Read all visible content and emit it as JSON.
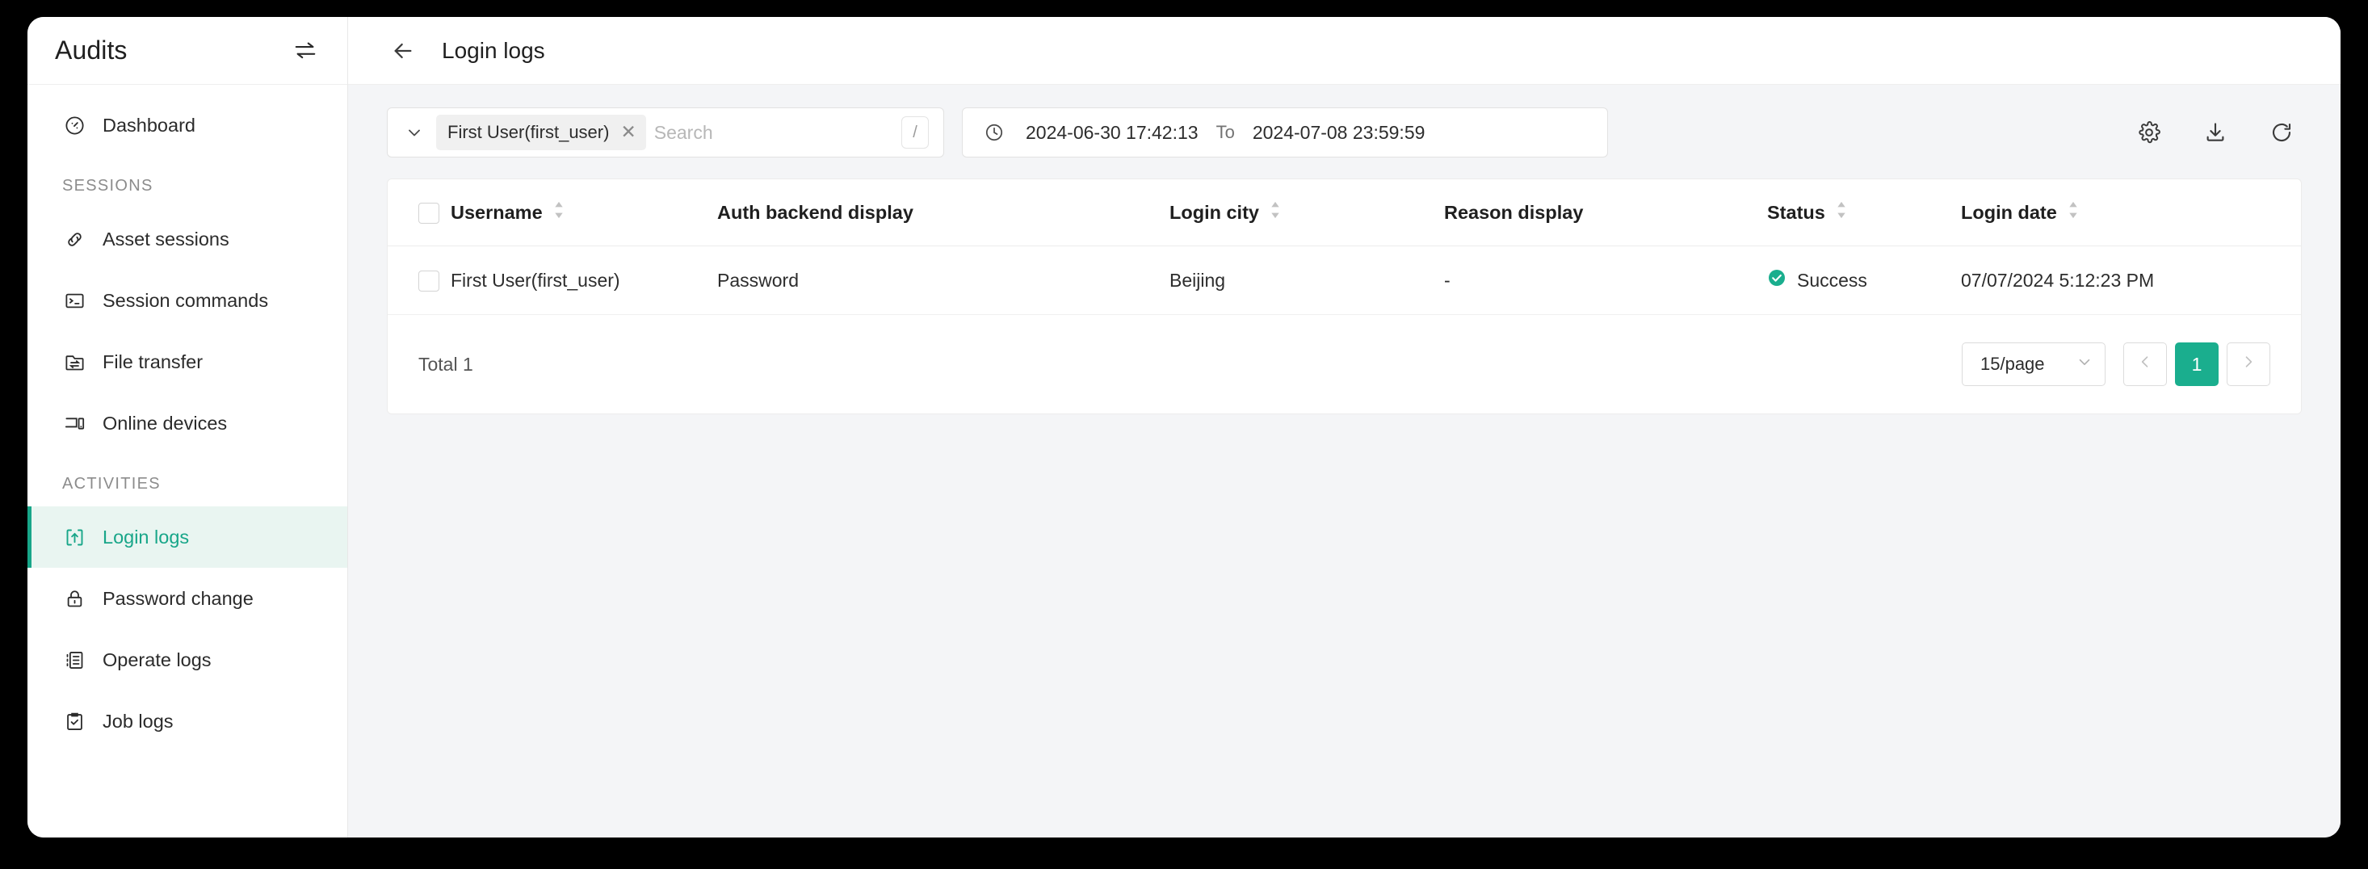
{
  "sidebar": {
    "title": "Audits",
    "toggle_icon": "collapse-toggle-icon",
    "items": [
      {
        "label": "Dashboard",
        "icon": "dashboard-icon",
        "active": false
      },
      {
        "label": "Asset sessions",
        "icon": "link-icon",
        "active": false
      },
      {
        "label": "Session commands",
        "icon": "terminal-icon",
        "active": false
      },
      {
        "label": "File transfer",
        "icon": "folder-transfer-icon",
        "active": false
      },
      {
        "label": "Online devices",
        "icon": "devices-icon",
        "active": false
      },
      {
        "label": "Login logs",
        "icon": "login-arrow-icon",
        "active": true
      },
      {
        "label": "Password change",
        "icon": "lock-icon",
        "active": false
      },
      {
        "label": "Operate logs",
        "icon": "list-document-icon",
        "active": false
      },
      {
        "label": "Job logs",
        "icon": "clipboard-check-icon",
        "active": false
      }
    ],
    "sections": {
      "sessions": "SESSIONS",
      "activities": "ACTIVITIES"
    }
  },
  "header": {
    "back_icon": "arrow-left-icon",
    "title": "Login logs"
  },
  "filters": {
    "expand_icon": "chevron-down-icon",
    "tag_label": "First User(first_user)",
    "tag_close_icon": "close-icon",
    "search_placeholder": "Search",
    "search_value": "",
    "shortcut_key": "/",
    "clock_icon": "clock-icon",
    "date_from": "2024-06-30 17:42:13",
    "date_separator": "To",
    "date_to": "2024-07-08 23:59:59"
  },
  "toolbar": {
    "settings_icon": "gear-icon",
    "export_icon": "download-icon",
    "refresh_icon": "refresh-icon"
  },
  "table": {
    "columns": [
      {
        "label": "",
        "sortable": false
      },
      {
        "label": "Username",
        "sortable": true
      },
      {
        "label": "Auth backend display",
        "sortable": false
      },
      {
        "label": "Login city",
        "sortable": true
      },
      {
        "label": "Reason display",
        "sortable": false
      },
      {
        "label": "Status",
        "sortable": true
      },
      {
        "label": "Login date",
        "sortable": true
      }
    ],
    "rows": [
      {
        "username": "First User(first_user)",
        "auth_backend_display": "Password",
        "login_city": "Beijing",
        "reason_display": "-",
        "status": "Success",
        "status_icon": "check-circle-icon",
        "login_date": "07/07/2024 5:12:23 PM"
      }
    ]
  },
  "footer": {
    "total_text": "Total 1",
    "page_size": "15/page",
    "page_size_icon": "chevron-down-icon",
    "prev_icon": "chevron-left-icon",
    "next_icon": "chevron-right-icon",
    "current_page": "1"
  },
  "colors": {
    "accent": "#1aae8e",
    "active_bg": "#e9f5f1",
    "success": "#1aae8e",
    "page_bg": "#f4f5f7"
  }
}
